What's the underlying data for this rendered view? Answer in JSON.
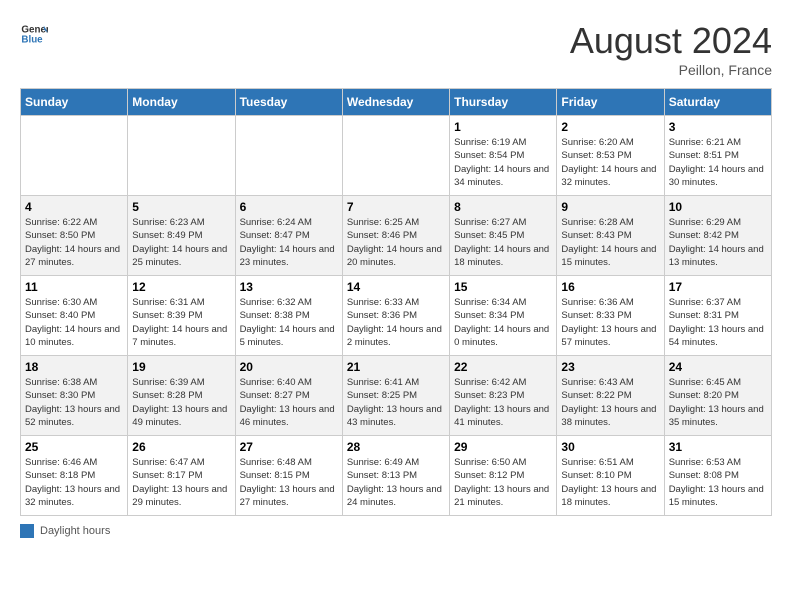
{
  "header": {
    "logo_line1": "General",
    "logo_line2": "Blue",
    "month_title": "August 2024",
    "location": "Peillon, France"
  },
  "days_of_week": [
    "Sunday",
    "Monday",
    "Tuesday",
    "Wednesday",
    "Thursday",
    "Friday",
    "Saturday"
  ],
  "weeks": [
    [
      {
        "day": "",
        "info": ""
      },
      {
        "day": "",
        "info": ""
      },
      {
        "day": "",
        "info": ""
      },
      {
        "day": "",
        "info": ""
      },
      {
        "day": "1",
        "info": "Sunrise: 6:19 AM\nSunset: 8:54 PM\nDaylight: 14 hours and 34 minutes."
      },
      {
        "day": "2",
        "info": "Sunrise: 6:20 AM\nSunset: 8:53 PM\nDaylight: 14 hours and 32 minutes."
      },
      {
        "day": "3",
        "info": "Sunrise: 6:21 AM\nSunset: 8:51 PM\nDaylight: 14 hours and 30 minutes."
      }
    ],
    [
      {
        "day": "4",
        "info": "Sunrise: 6:22 AM\nSunset: 8:50 PM\nDaylight: 14 hours and 27 minutes."
      },
      {
        "day": "5",
        "info": "Sunrise: 6:23 AM\nSunset: 8:49 PM\nDaylight: 14 hours and 25 minutes."
      },
      {
        "day": "6",
        "info": "Sunrise: 6:24 AM\nSunset: 8:47 PM\nDaylight: 14 hours and 23 minutes."
      },
      {
        "day": "7",
        "info": "Sunrise: 6:25 AM\nSunset: 8:46 PM\nDaylight: 14 hours and 20 minutes."
      },
      {
        "day": "8",
        "info": "Sunrise: 6:27 AM\nSunset: 8:45 PM\nDaylight: 14 hours and 18 minutes."
      },
      {
        "day": "9",
        "info": "Sunrise: 6:28 AM\nSunset: 8:43 PM\nDaylight: 14 hours and 15 minutes."
      },
      {
        "day": "10",
        "info": "Sunrise: 6:29 AM\nSunset: 8:42 PM\nDaylight: 14 hours and 13 minutes."
      }
    ],
    [
      {
        "day": "11",
        "info": "Sunrise: 6:30 AM\nSunset: 8:40 PM\nDaylight: 14 hours and 10 minutes."
      },
      {
        "day": "12",
        "info": "Sunrise: 6:31 AM\nSunset: 8:39 PM\nDaylight: 14 hours and 7 minutes."
      },
      {
        "day": "13",
        "info": "Sunrise: 6:32 AM\nSunset: 8:38 PM\nDaylight: 14 hours and 5 minutes."
      },
      {
        "day": "14",
        "info": "Sunrise: 6:33 AM\nSunset: 8:36 PM\nDaylight: 14 hours and 2 minutes."
      },
      {
        "day": "15",
        "info": "Sunrise: 6:34 AM\nSunset: 8:34 PM\nDaylight: 14 hours and 0 minutes."
      },
      {
        "day": "16",
        "info": "Sunrise: 6:36 AM\nSunset: 8:33 PM\nDaylight: 13 hours and 57 minutes."
      },
      {
        "day": "17",
        "info": "Sunrise: 6:37 AM\nSunset: 8:31 PM\nDaylight: 13 hours and 54 minutes."
      }
    ],
    [
      {
        "day": "18",
        "info": "Sunrise: 6:38 AM\nSunset: 8:30 PM\nDaylight: 13 hours and 52 minutes."
      },
      {
        "day": "19",
        "info": "Sunrise: 6:39 AM\nSunset: 8:28 PM\nDaylight: 13 hours and 49 minutes."
      },
      {
        "day": "20",
        "info": "Sunrise: 6:40 AM\nSunset: 8:27 PM\nDaylight: 13 hours and 46 minutes."
      },
      {
        "day": "21",
        "info": "Sunrise: 6:41 AM\nSunset: 8:25 PM\nDaylight: 13 hours and 43 minutes."
      },
      {
        "day": "22",
        "info": "Sunrise: 6:42 AM\nSunset: 8:23 PM\nDaylight: 13 hours and 41 minutes."
      },
      {
        "day": "23",
        "info": "Sunrise: 6:43 AM\nSunset: 8:22 PM\nDaylight: 13 hours and 38 minutes."
      },
      {
        "day": "24",
        "info": "Sunrise: 6:45 AM\nSunset: 8:20 PM\nDaylight: 13 hours and 35 minutes."
      }
    ],
    [
      {
        "day": "25",
        "info": "Sunrise: 6:46 AM\nSunset: 8:18 PM\nDaylight: 13 hours and 32 minutes."
      },
      {
        "day": "26",
        "info": "Sunrise: 6:47 AM\nSunset: 8:17 PM\nDaylight: 13 hours and 29 minutes."
      },
      {
        "day": "27",
        "info": "Sunrise: 6:48 AM\nSunset: 8:15 PM\nDaylight: 13 hours and 27 minutes."
      },
      {
        "day": "28",
        "info": "Sunrise: 6:49 AM\nSunset: 8:13 PM\nDaylight: 13 hours and 24 minutes."
      },
      {
        "day": "29",
        "info": "Sunrise: 6:50 AM\nSunset: 8:12 PM\nDaylight: 13 hours and 21 minutes."
      },
      {
        "day": "30",
        "info": "Sunrise: 6:51 AM\nSunset: 8:10 PM\nDaylight: 13 hours and 18 minutes."
      },
      {
        "day": "31",
        "info": "Sunrise: 6:53 AM\nSunset: 8:08 PM\nDaylight: 13 hours and 15 minutes."
      }
    ]
  ],
  "legend": {
    "label": "Daylight hours"
  }
}
